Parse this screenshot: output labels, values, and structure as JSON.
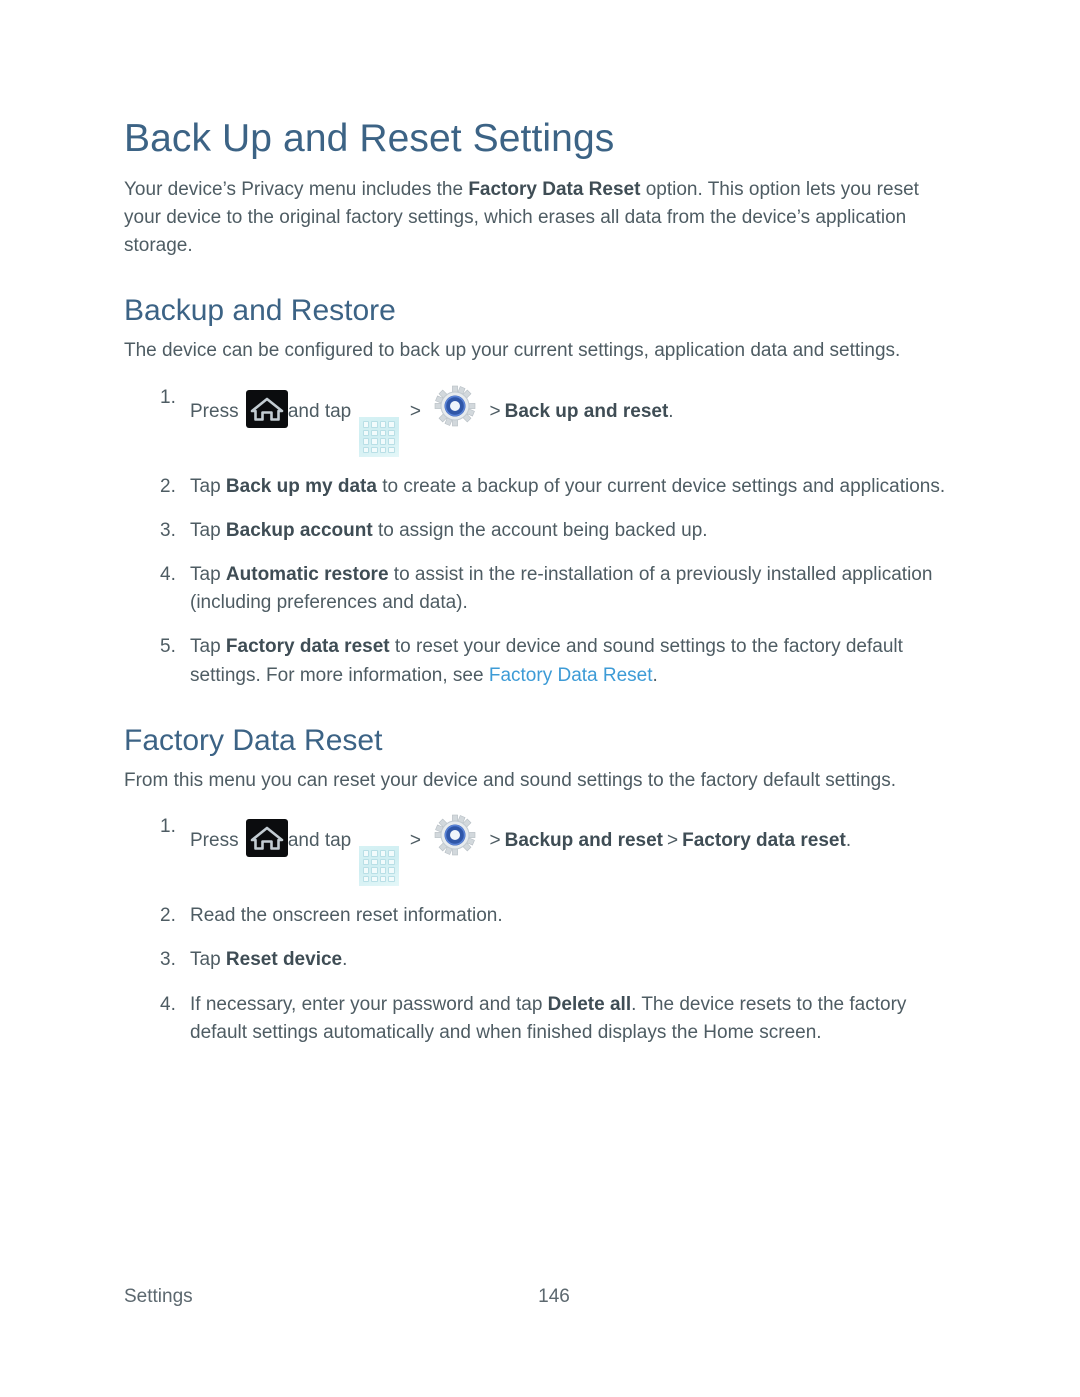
{
  "document": {
    "title": "Back Up and Reset Settings",
    "intro_parts": [
      {
        "text": "Your device’s Privacy menu includes the ",
        "bold": false
      },
      {
        "text": "Factory Data Reset",
        "bold": true
      },
      {
        "text": " option. This option lets you reset your device to the original factory settings, which erases all data from the device’s application storage.",
        "bold": false
      }
    ],
    "intro_plain": "Your device’s Privacy menu includes the Factory Data Reset option. This option lets you reset your device to the original factory settings, which erases all data from the device’s application storage."
  },
  "sections": [
    {
      "heading": "Backup and Restore",
      "lead": "The device can be configured to back up your current settings, application data and settings.",
      "steps": [
        {
          "number": "1.",
          "kind": "icon-path",
          "press_label": "Press",
          "and_tap_label": "and tap",
          "icons": [
            "home-icon",
            "apps-grid-icon",
            "settings-gear-icon"
          ],
          "separator": ">",
          "target_bold": "Back up and reset",
          "trailing": "."
        },
        {
          "number": "2.",
          "kind": "text",
          "prefix": "Tap ",
          "bold": "Back up my data",
          "suffix": " to create a backup of your current device settings and applications."
        },
        {
          "number": "3.",
          "kind": "text",
          "prefix": "Tap ",
          "bold": "Backup account",
          "suffix": " to assign the account being backed up."
        },
        {
          "number": "4.",
          "kind": "text",
          "prefix": "Tap ",
          "bold": "Automatic restore",
          "suffix": " to assist in the re-installation of a previously installed application (including preferences and data)."
        },
        {
          "number": "5.",
          "kind": "link",
          "prefix": "Tap ",
          "bold": "Factory data reset",
          "suffix": " to reset your device and sound settings to the factory default settings. For more information, see ",
          "link_text": "Factory Data Reset",
          "trailing": "."
        }
      ]
    },
    {
      "heading": "Factory Data Reset",
      "lead": "From this menu you can reset your device and sound settings to the factory default settings.",
      "steps": [
        {
          "number": "1.",
          "kind": "icon-path",
          "press_label": "Press",
          "and_tap_label": "and tap",
          "icons": [
            "home-icon",
            "apps-grid-icon",
            "settings-gear-icon"
          ],
          "separator": ">",
          "target_bold": "Backup and reset",
          "target_bold_2": "Factory data reset",
          "trailing": "."
        },
        {
          "number": "2.",
          "kind": "text",
          "prefix": "Read the onscreen reset information.",
          "bold": "",
          "suffix": ""
        },
        {
          "number": "3.",
          "kind": "text",
          "prefix": "Tap ",
          "bold": "Reset device",
          "suffix": "."
        },
        {
          "number": "4.",
          "kind": "text",
          "prefix": "If necessary, enter your password and tap ",
          "bold": "Delete all",
          "suffix": ". The device resets to the factory default settings automatically and when finished displays the Home screen."
        }
      ]
    }
  ],
  "footer": {
    "left": "Settings",
    "page_number": "146"
  },
  "colors": {
    "heading": "#3c6385",
    "body": "#4e5c63",
    "link": "#3d9bd6",
    "home_icon_bg": "#0b0c0e",
    "apps_icon_bg": "#d7f2f4",
    "gear_blue": "#2f56a8"
  }
}
